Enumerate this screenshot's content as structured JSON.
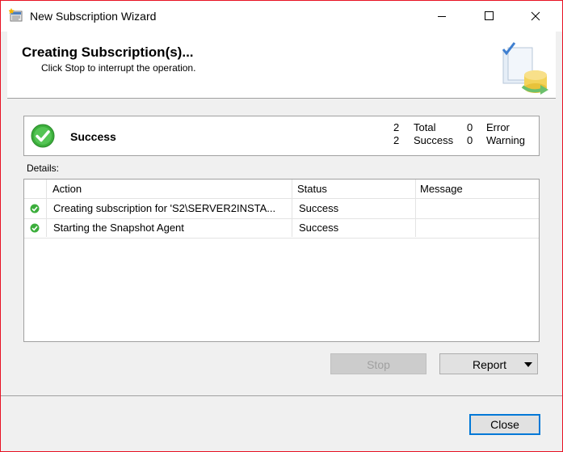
{
  "window": {
    "title": "New Subscription Wizard"
  },
  "header": {
    "title": "Creating Subscription(s)...",
    "subtitle": "Click Stop to interrupt the operation."
  },
  "summary": {
    "status": "Success",
    "total_count": "2",
    "total_label": "Total",
    "success_count": "2",
    "success_label": "Success",
    "error_count": "0",
    "error_label": "Error",
    "warning_count": "0",
    "warning_label": "Warning"
  },
  "details": {
    "label": "Details:",
    "columns": {
      "action": "Action",
      "status": "Status",
      "message": "Message"
    },
    "rows": [
      {
        "action": "Creating subscription for 'S2\\SERVER2INSTA...",
        "status": "Success",
        "message": ""
      },
      {
        "action": "Starting the Snapshot Agent",
        "status": "Success",
        "message": ""
      }
    ]
  },
  "buttons": {
    "stop": "Stop",
    "report": "Report",
    "close": "Close"
  },
  "colors": {
    "success_green": "#2e9e2e",
    "window_border": "#e81123",
    "focus_blue": "#0078d7"
  }
}
